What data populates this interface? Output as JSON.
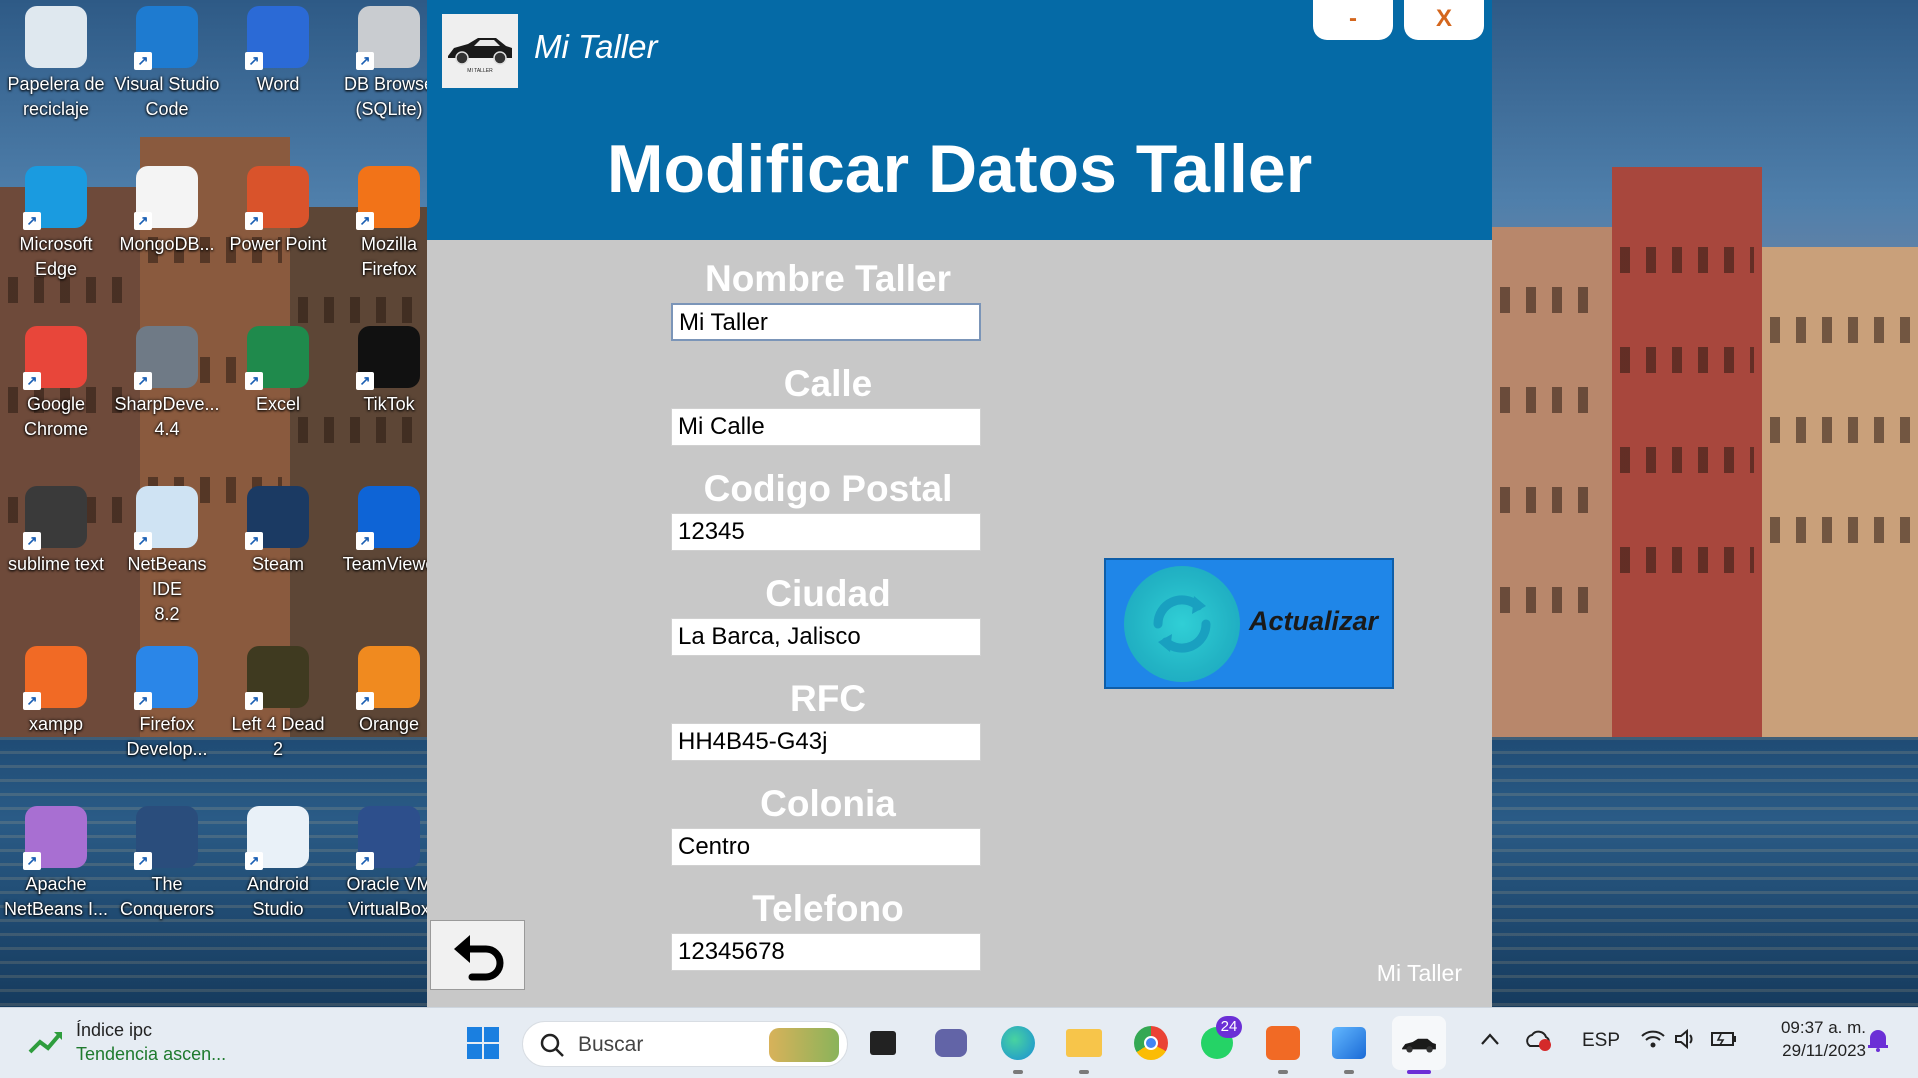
{
  "desktop": {
    "icons": [
      {
        "label": "Papelera de\nreciclaje",
        "icon": "recycle-bin-icon",
        "color": "#dfe8ef"
      },
      {
        "label": "Visual Studio\nCode",
        "icon": "vscode-icon",
        "color": "#1e7bd0"
      },
      {
        "label": "Word",
        "icon": "word-icon",
        "color": "#2b6ad6"
      },
      {
        "label": "DB Browse\n(SQLite)",
        "icon": "database-icon",
        "color": "#c9ccd0"
      },
      {
        "label": "Microsoft\nEdge",
        "icon": "edge-icon",
        "color": "#1a9be0"
      },
      {
        "label": "MongoDB...",
        "icon": "mongodb-icon",
        "color": "#f4f4f4"
      },
      {
        "label": "Power Point",
        "icon": "powerpoint-icon",
        "color": "#d9532b"
      },
      {
        "label": "Mozilla\nFirefox",
        "icon": "firefox-icon",
        "color": "#f27318"
      },
      {
        "label": "Google\nChrome",
        "icon": "chrome-icon",
        "color": "#e8463a"
      },
      {
        "label": "SharpDeve...\n4.4",
        "icon": "sharpdevelop-icon",
        "color": "#6f7a86"
      },
      {
        "label": "Excel",
        "icon": "excel-icon",
        "color": "#1f8a4c"
      },
      {
        "label": "TikTok",
        "icon": "tiktok-icon",
        "color": "#111111"
      },
      {
        "label": "sublime text",
        "icon": "sublime-icon",
        "color": "#3a3a3a"
      },
      {
        "label": "NetBeans IDE\n8.2",
        "icon": "netbeans-icon",
        "color": "#cfe3f3"
      },
      {
        "label": "Steam",
        "icon": "steam-icon",
        "color": "#1b3a63"
      },
      {
        "label": "TeamViewe",
        "icon": "teamviewer-icon",
        "color": "#0e64d6"
      },
      {
        "label": "xampp",
        "icon": "xampp-icon",
        "color": "#f16a25"
      },
      {
        "label": "Firefox\nDevelop...",
        "icon": "firefox-dev-icon",
        "color": "#2a86e8"
      },
      {
        "label": "Left 4 Dead 2",
        "icon": "left4dead-icon",
        "color": "#3f3a20"
      },
      {
        "label": "Orange",
        "icon": "orange-icon",
        "color": "#f08a1f"
      },
      {
        "label": "Apache\nNetBeans I...",
        "icon": "apache-netbeans-icon",
        "color": "#a86fd2"
      },
      {
        "label": "The\nConquerors",
        "icon": "conquerors-icon",
        "color": "#2a4d7c"
      },
      {
        "label": "Android\nStudio",
        "icon": "android-studio-icon",
        "color": "#e9f1f8"
      },
      {
        "label": "Oracle VM\nVirtualBox",
        "icon": "virtualbox-icon",
        "color": "#2d4f8c"
      }
    ]
  },
  "app": {
    "window_name": "Mi Taller",
    "logo_text": "MI TALLER",
    "title": "Modificar Datos Taller",
    "minimize_label": "-",
    "close_label": "X",
    "fields": [
      {
        "label": "Nombre Taller",
        "value": "Mi Taller"
      },
      {
        "label": "Calle",
        "value": "Mi Calle"
      },
      {
        "label": "Codigo Postal",
        "value": "12345"
      },
      {
        "label": "Ciudad",
        "value": "La Barca, Jalisco"
      },
      {
        "label": "RFC",
        "value": "HH4B45-G43j"
      },
      {
        "label": "Colonia",
        "value": "Centro"
      },
      {
        "label": "Telefono",
        "value": "12345678"
      }
    ],
    "update_button": "Actualizar",
    "footer_brand": "Mi Taller",
    "colors": {
      "header": "#056aa6",
      "body": "#c8c8c8",
      "update_button": "#1f86e8"
    }
  },
  "taskbar": {
    "widget_title": "Índice ipc",
    "widget_sub": "Tendencia ascen...",
    "search_placeholder": "Buscar",
    "whatsapp_badge": "24",
    "lang": "ESP",
    "time": "09:37 a. m.",
    "date": "29/11/2023"
  }
}
